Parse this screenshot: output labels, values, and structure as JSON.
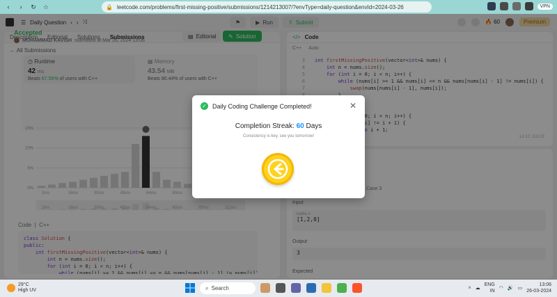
{
  "browser": {
    "url": "leetcode.com/problems/first-missing-positive/submissions/1214213007/?envType=daily-question&envId=2024-03-26",
    "vpn_label": "VPN"
  },
  "topbar": {
    "daily_question": "Daily Question",
    "run": "Run",
    "submit": "Submit",
    "streak_count": "60",
    "premium": "Premium"
  },
  "left": {
    "tabs": [
      "Description",
      "Editorial",
      "Solutions",
      "Submissions"
    ],
    "all_submissions": "All Submissions",
    "status": "Accepted",
    "submitter": "MOHAMMAD KAVISH",
    "submitted_text": "submitted at Mar 26, 2024 13:06",
    "editorial_btn": "Editorial",
    "solution_btn": "Solution",
    "runtime_label": "Runtime",
    "runtime_value": "42",
    "runtime_unit": "ms",
    "runtime_beats_pct": "67.55%",
    "runtime_beats_suffix": "of users with C++",
    "runtime_beats_prefix": "Beats",
    "memory_label": "Memory",
    "memory_value": "43.54",
    "memory_unit": "MB",
    "memory_beats": "Beats 80.44% of users with C++",
    "code_label": "Code",
    "code_lang": "C++"
  },
  "chart_data": {
    "type": "bar",
    "y_ticks": [
      "15%",
      "10%",
      "5%",
      "0%"
    ],
    "x_ticks": [
      "2ms",
      "16ms",
      "30ms",
      "45ms",
      "64ms",
      "80ms",
      "95ms",
      "111ms"
    ],
    "ylim": [
      0,
      15
    ],
    "highlight_x": "42ms",
    "bars": [
      0.5,
      0.8,
      1.2,
      1.5,
      2,
      2.5,
      3,
      3.5,
      4,
      11,
      13,
      4,
      2,
      1.5,
      1,
      0.8,
      0.6,
      0.5,
      0.4,
      0.3
    ]
  },
  "right": {
    "code_tab": "Code",
    "lang": "C++",
    "auto": "Auto",
    "cursor": "Ln 17, Col 22",
    "case": "Case 3",
    "input_label": "Input",
    "input_name": "nums =",
    "input_value": "[1,2,0]",
    "output_label": "Output",
    "output_value": "3",
    "expected_label": "Expected"
  },
  "modal": {
    "title": "Daily Coding Challenge Completed!",
    "streak_label": "Completion Streak:",
    "streak_value": "60",
    "streak_unit": "Days",
    "subtitle": "Consistency is key, see you tomorrow!"
  },
  "taskbar": {
    "temp": "29°C",
    "weather": "High UV",
    "search": "Search",
    "lang_top": "ENG",
    "lang_bottom": "IN",
    "time": "13:06",
    "date": "26-03-2024"
  }
}
